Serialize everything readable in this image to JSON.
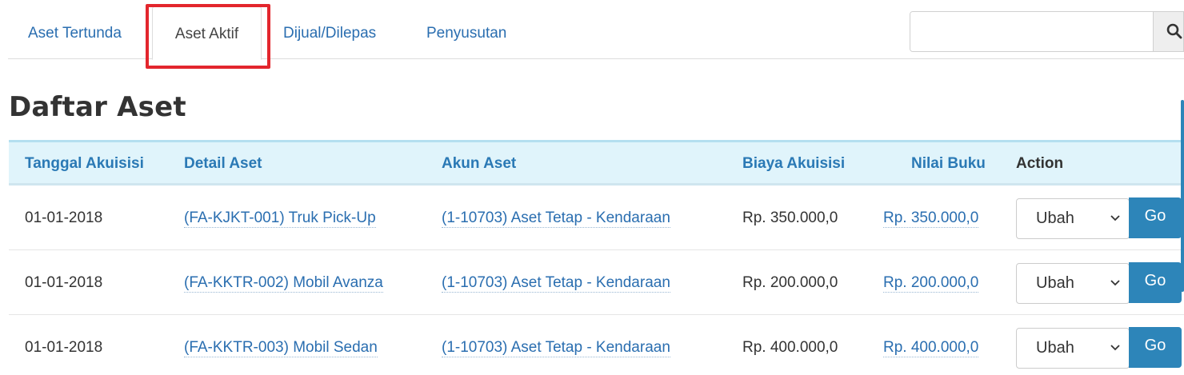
{
  "tabs": [
    {
      "label": "Aset Tertunda",
      "active": false
    },
    {
      "label": "Aset Aktif",
      "active": true
    },
    {
      "label": "Dijual/Dilepas",
      "active": false
    },
    {
      "label": "Penyusutan",
      "active": false
    }
  ],
  "search": {
    "value": "",
    "placeholder": "",
    "icon": "search-icon"
  },
  "page_title": "Daftar Aset",
  "table": {
    "headers": [
      "Tanggal Akuisisi",
      "Detail Aset",
      "Akun Aset",
      "Biaya Akuisisi",
      "Nilai Buku",
      "Action"
    ],
    "rows": [
      {
        "date": "01-01-2018",
        "detail": "(FA-KJKT-001) Truk Pick-Up",
        "account": "(1-10703) Aset Tetap - Kendaraan",
        "cost": "Rp. 350.000,0",
        "book_value": "Rp. 350.000,0",
        "action": "Ubah",
        "go": "Go"
      },
      {
        "date": "01-01-2018",
        "detail": "(FA-KKTR-002) Mobil Avanza",
        "account": "(1-10703) Aset Tetap - Kendaraan",
        "cost": "Rp. 200.000,0",
        "book_value": "Rp. 200.000,0",
        "action": "Ubah",
        "go": "Go"
      },
      {
        "date": "01-01-2018",
        "detail": "(FA-KKTR-003) Mobil Sedan",
        "account": "(1-10703) Aset Tetap - Kendaraan",
        "cost": "Rp. 400.000,0",
        "book_value": "Rp. 400.000,0",
        "action": "Ubah",
        "go": "Go"
      }
    ]
  },
  "colors": {
    "link": "#2a6eb0",
    "header_bg": "#e0f4fb",
    "go_button": "#2d85b9",
    "highlight": "#e3262d"
  }
}
